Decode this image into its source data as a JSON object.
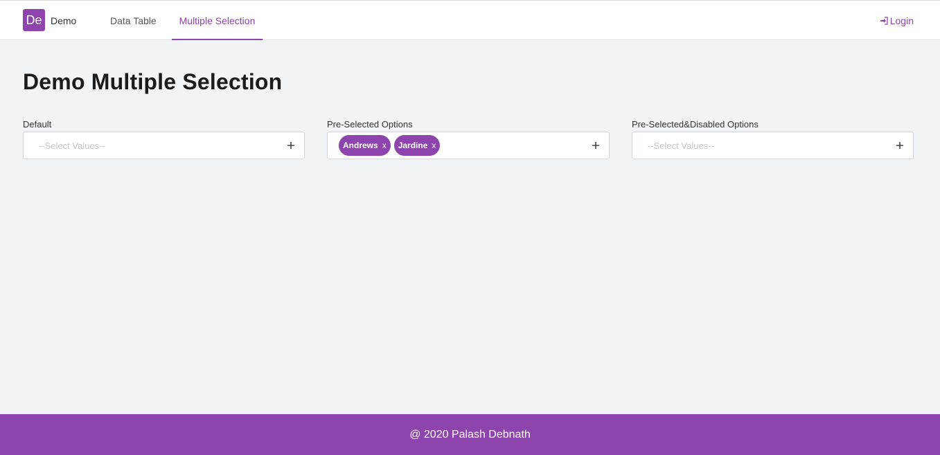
{
  "brand": {
    "logo_text": "De",
    "name": "Demo"
  },
  "nav": {
    "items": [
      {
        "label": "Data Table",
        "active": false
      },
      {
        "label": "Multiple Selection",
        "active": true
      }
    ],
    "login_label": "Login"
  },
  "page": {
    "title": "Demo Multiple Selection"
  },
  "fields": [
    {
      "label": "Default",
      "placeholder": "--Select Values--",
      "chips": []
    },
    {
      "label": "Pre-Selected Options",
      "placeholder": "",
      "chips": [
        "Andrews",
        "Jardine"
      ],
      "chip_remove": "x"
    },
    {
      "label": "Pre-Selected&Disabled Options",
      "placeholder": "--Select Values--",
      "chips": []
    }
  ],
  "footer": {
    "text": "@ 2020 Palash Debnath"
  },
  "colors": {
    "accent": "#8e44ad",
    "background": "#f1f4f7"
  },
  "icons": {
    "login": "sign-in-icon",
    "add": "plus-icon",
    "remove": "close-x"
  }
}
